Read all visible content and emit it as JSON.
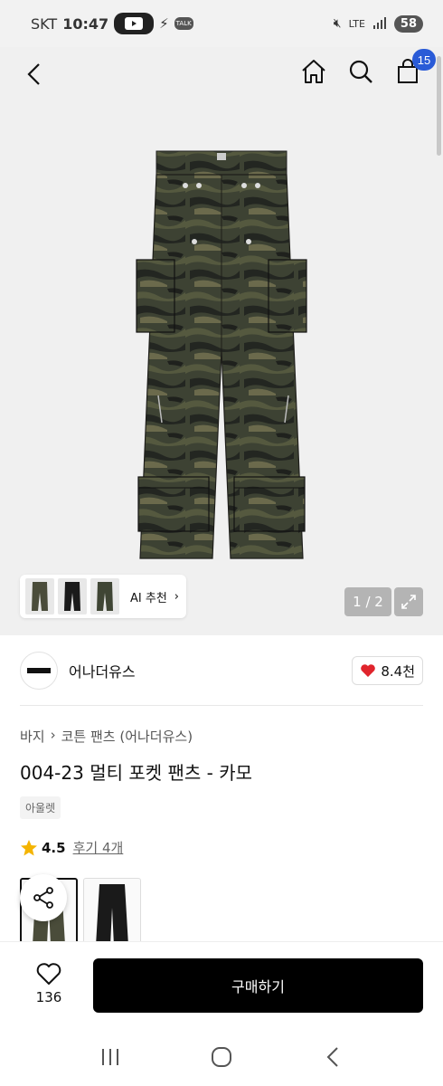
{
  "status_bar": {
    "carrier": "SKT",
    "time": "10:47",
    "network": "LTE",
    "battery": "58"
  },
  "header": {
    "cart_count": "15"
  },
  "hero": {
    "ai_label": "AI 추천",
    "pager": "1 / 2"
  },
  "brand": {
    "name": "어나더유스",
    "likes": "8.4천",
    "like_color": "#e0242c"
  },
  "breadcrumb": {
    "category": "바지",
    "subcategory": "코튼 팬츠 (어나더유스)"
  },
  "product": {
    "title": "004-23 멀티 포켓 팬츠 - 카모",
    "tag": "아울렛",
    "rating": "4.5",
    "reviews": "후기 4개"
  },
  "bottom": {
    "wish_count": "136",
    "buy_label": "구매하기"
  },
  "colors": {
    "accent": "#2a5bd7",
    "star": "#f4b400",
    "camo_base": "#3d4233"
  }
}
